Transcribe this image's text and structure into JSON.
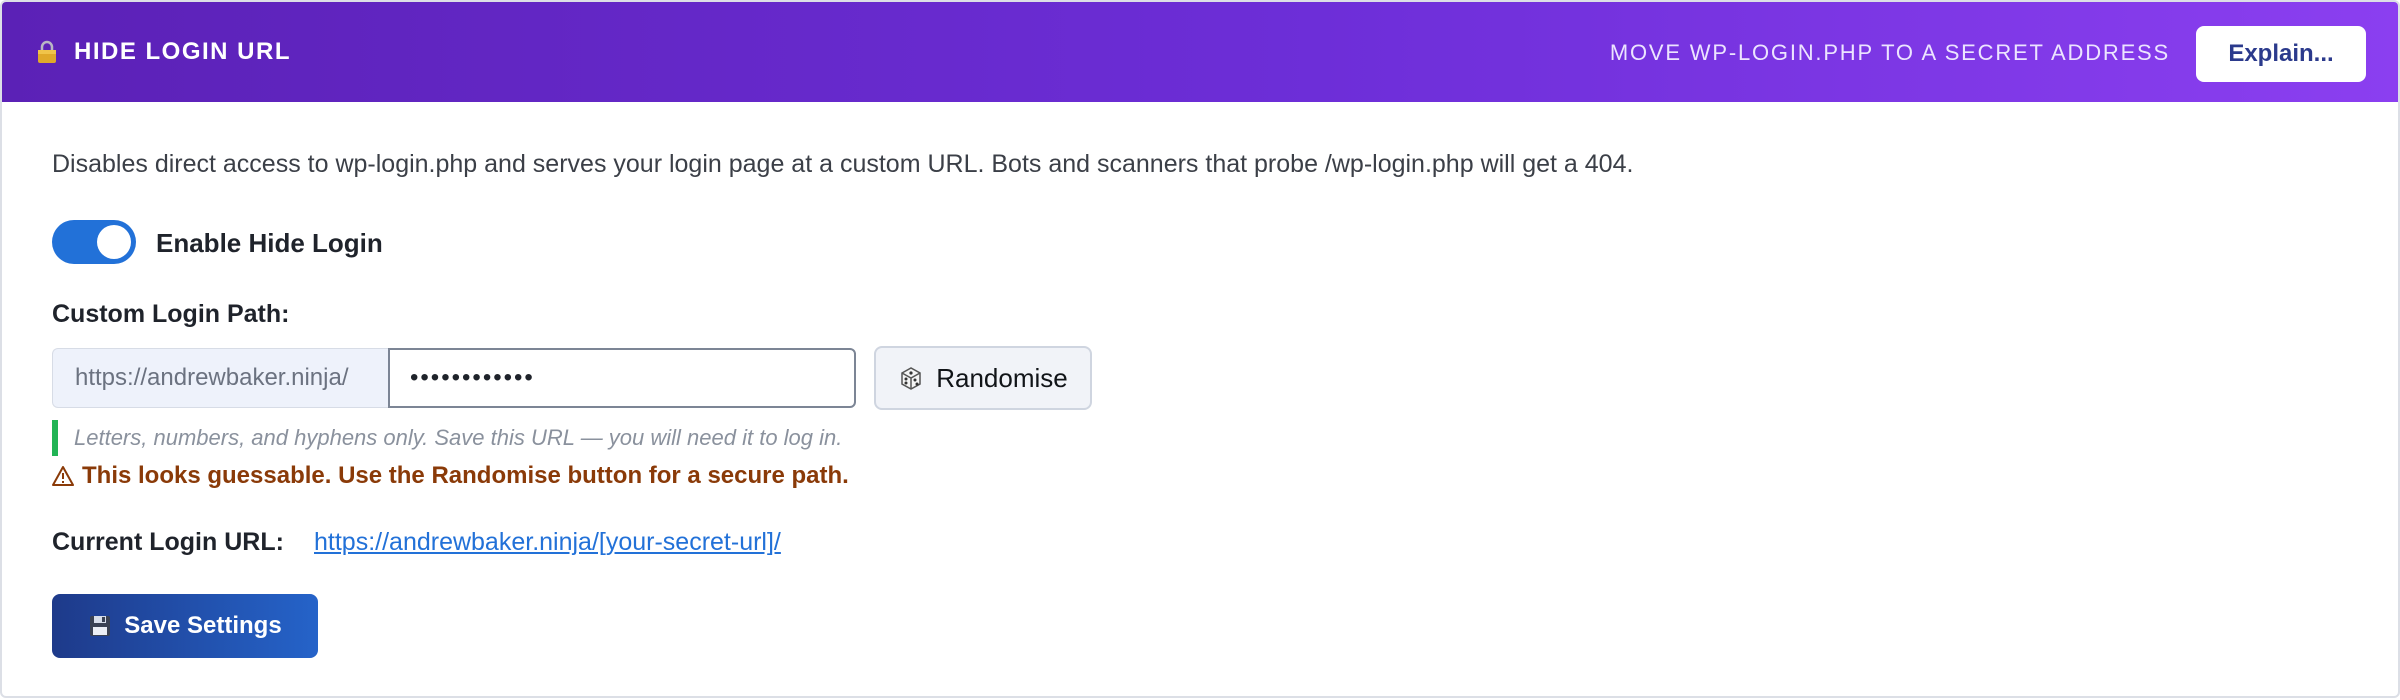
{
  "header": {
    "title": "HIDE LOGIN URL",
    "icon": "lock-icon",
    "subtitle": "MOVE WP-LOGIN.PHP TO A SECRET ADDRESS",
    "explain_label": "Explain..."
  },
  "description": "Disables direct access to wp-login.php and serves your login page at a custom URL. Bots and scanners that probe /wp-login.php will get a 404.",
  "toggle": {
    "label": "Enable Hide Login",
    "enabled": true
  },
  "custom_path": {
    "label": "Custom Login Path:",
    "prefix": "https://andrewbaker.ninja/",
    "value": "••••••••••••",
    "randomise_label": "Randomise",
    "randomise_icon": "dice-icon"
  },
  "hint": "Letters, numbers, and hyphens only. Save this URL — you will need it to log in.",
  "warning": {
    "icon": "warning-icon",
    "text": "This looks guessable. Use the Randomise button for a secure path."
  },
  "current_url": {
    "label": "Current Login URL:",
    "link": "https://andrewbaker.ninja/[your-secret-url]/"
  },
  "save": {
    "label": "Save Settings",
    "icon": "floppy-disk-icon"
  },
  "colors": {
    "header_start": "#5b21b6",
    "header_end": "#8b3ff0",
    "toggle_on": "#2271d8",
    "hint_bar": "#22b455",
    "warning_text": "#8a3a08",
    "link": "#2271d8",
    "save_start": "#1e3a8a",
    "save_end": "#2563c9"
  }
}
